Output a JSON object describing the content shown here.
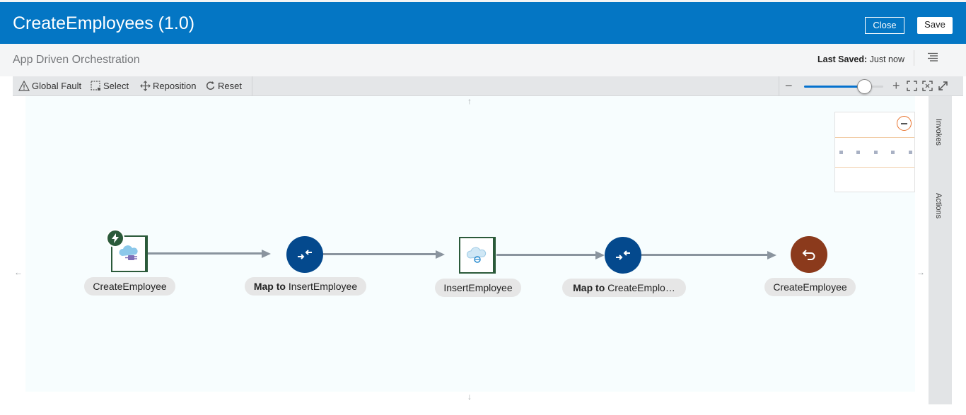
{
  "header": {
    "title": "CreateEmployees (1.0)",
    "close_label": "Close",
    "save_label": "Save"
  },
  "subheader": {
    "subtitle": "App Driven Orchestration",
    "last_saved_label": "Last Saved:",
    "last_saved_value": "Just now",
    "menu_icon": "hamburger-menu-icon"
  },
  "toolbar": {
    "global_fault": "Global Fault",
    "select": "Select",
    "reposition": "Reposition",
    "reset": "Reset",
    "zoom_level": 0.76
  },
  "side_panel": {
    "invokes": "Invokes",
    "actions": "Actions"
  },
  "flow": {
    "nodes": [
      {
        "kind": "trigger",
        "icon": "cloud-plug-icon",
        "badge_icon": "lightning-icon",
        "label": "CreateEmployee"
      },
      {
        "kind": "map",
        "icon": "map-arrows-icon",
        "label_prefix": "Map to",
        "label": "InsertEmployee"
      },
      {
        "kind": "invoke",
        "icon": "cloud-adapter-icon",
        "label": "InsertEmployee"
      },
      {
        "kind": "map",
        "icon": "map-arrows-icon",
        "label_prefix": "Map to",
        "label": "CreateEmplo…"
      },
      {
        "kind": "return",
        "icon": "return-arrow-icon",
        "label": "CreateEmployee"
      }
    ]
  },
  "colors": {
    "header_bg": "#0476c4",
    "map_node": "#04498d",
    "return_node": "#8b3a1c",
    "adapter_border": "#2b5a3a",
    "zoom_fill": "#0572ce"
  }
}
